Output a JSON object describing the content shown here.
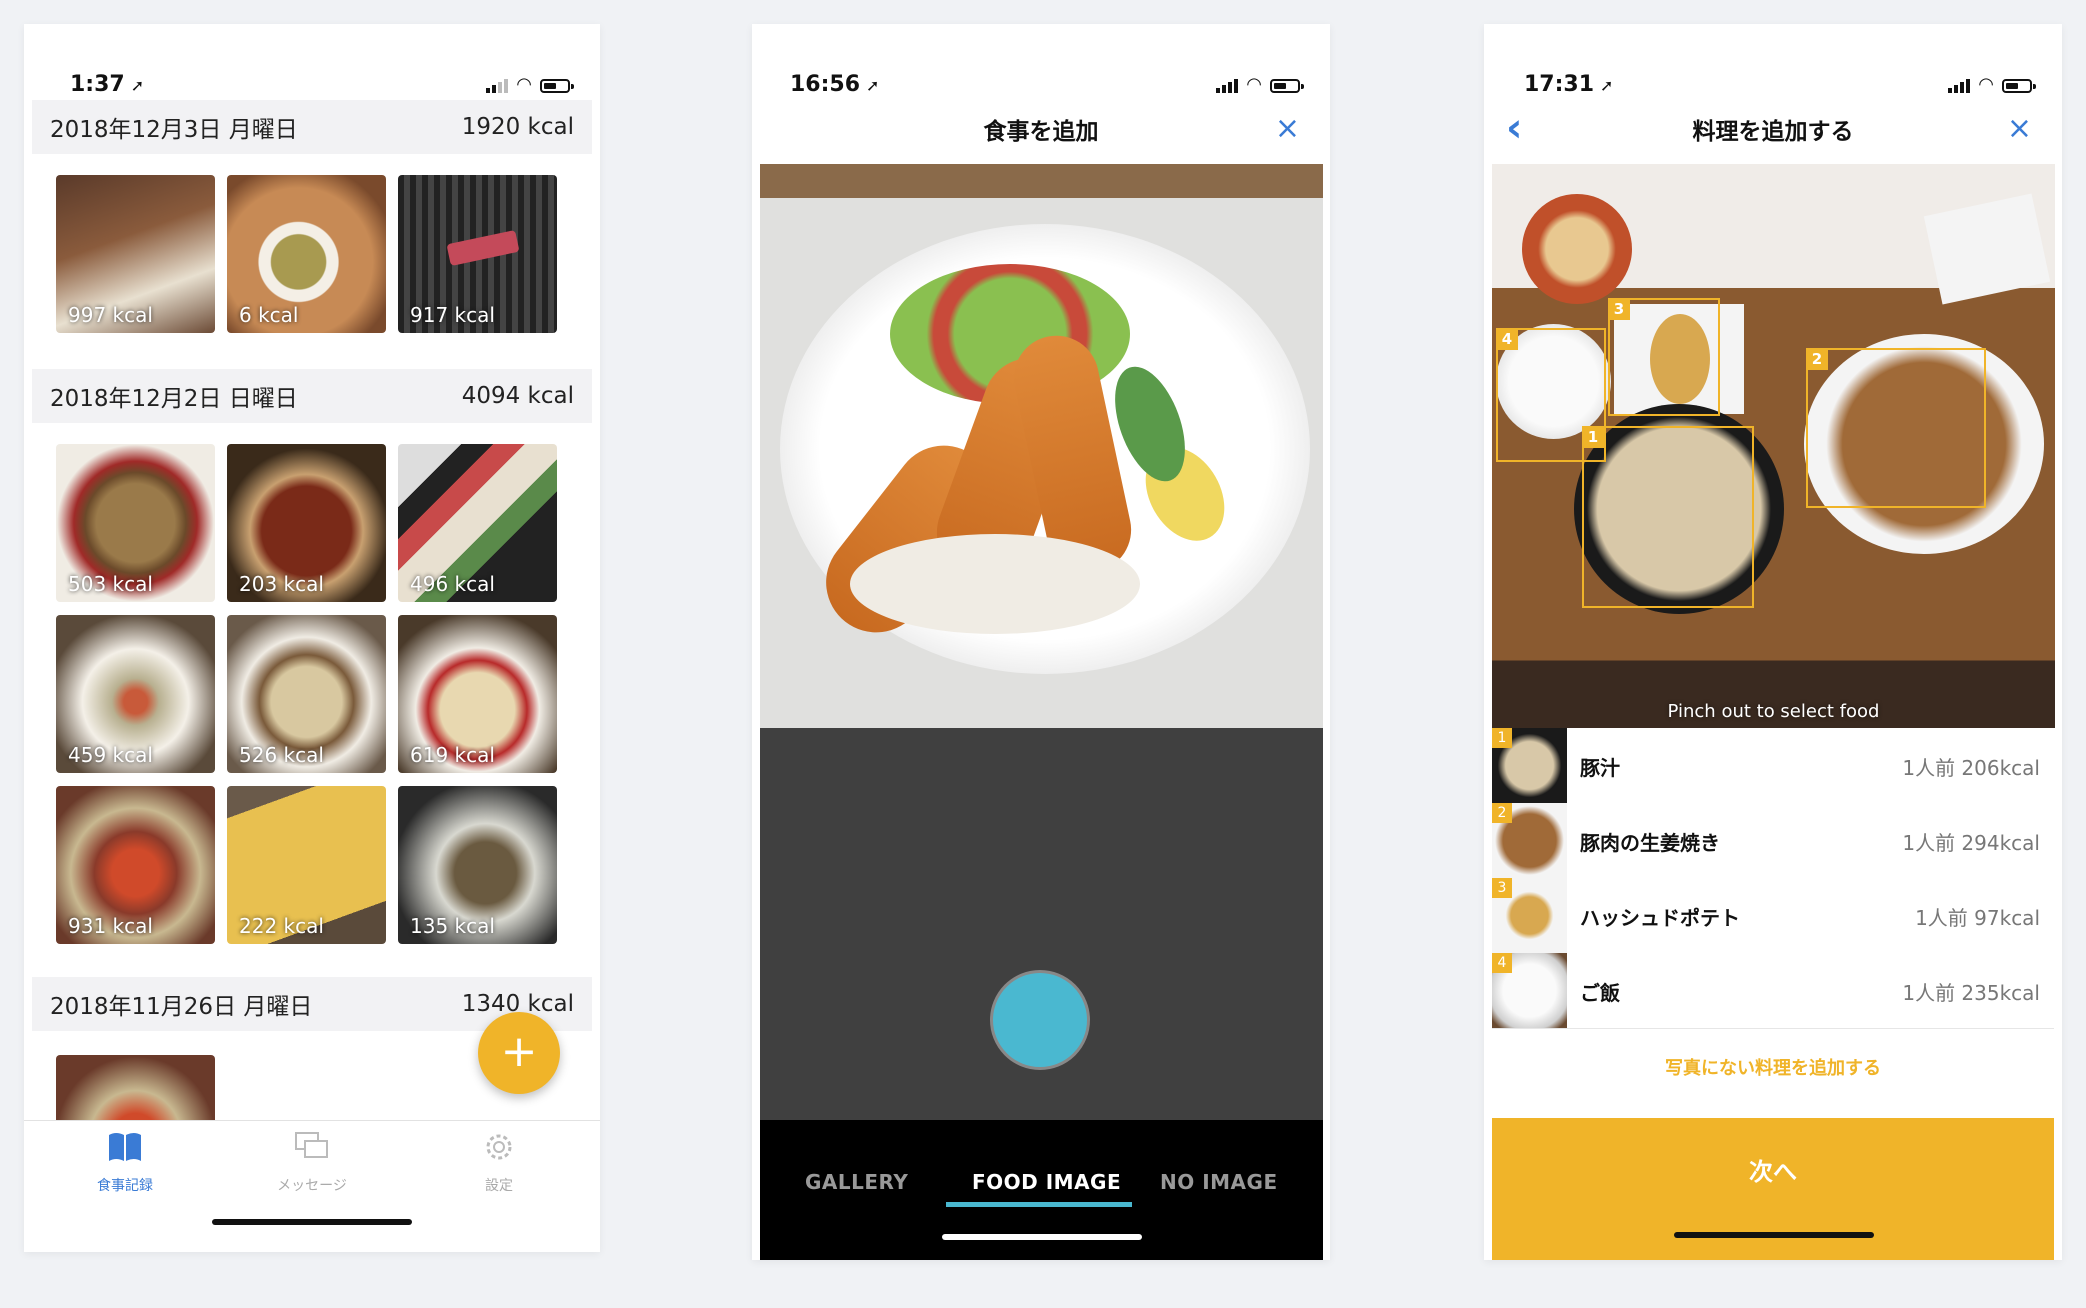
{
  "phone1": {
    "time": "1:37",
    "days": [
      {
        "date": "2018年12月3日 月曜日",
        "kcal": "1920 kcal",
        "items": [
          "997 kcal",
          "6 kcal",
          "917 kcal"
        ]
      },
      {
        "date": "2018年12月2日 日曜日",
        "kcal": "4094 kcal",
        "items": [
          "503 kcal",
          "203 kcal",
          "496 kcal",
          "459 kcal",
          "526 kcal",
          "619 kcal",
          "931 kcal",
          "222 kcal",
          "135 kcal"
        ]
      },
      {
        "date": "2018年11月26日 月曜日",
        "kcal": "1340 kcal",
        "items": []
      }
    ],
    "fab_label": "+",
    "tabs": [
      {
        "label": "食事記録",
        "icon": "book-icon",
        "active": true
      },
      {
        "label": "メッセージ",
        "icon": "chat-icon",
        "active": false
      },
      {
        "label": "設定",
        "icon": "gear-icon",
        "active": false
      }
    ]
  },
  "phone2": {
    "time": "16:56",
    "title": "食事を追加",
    "close": "×",
    "tabs": [
      {
        "label": "GALLERY",
        "active": false
      },
      {
        "label": "FOOD IMAGE",
        "active": true
      },
      {
        "label": "NO IMAGE",
        "active": false
      }
    ]
  },
  "phone3": {
    "time": "17:31",
    "title": "料理を追加する",
    "back": "‹",
    "close": "×",
    "hint": "Pinch out to select food",
    "dishes": [
      {
        "num": "1",
        "name": "豚汁",
        "kcal": "1人前 206kcal"
      },
      {
        "num": "2",
        "name": "豚肉の生姜焼き",
        "kcal": "1人前 294kcal"
      },
      {
        "num": "3",
        "name": "ハッシュドポテト",
        "kcal": "1人前 97kcal"
      },
      {
        "num": "4",
        "name": "ご飯",
        "kcal": "1人前 235kcal"
      }
    ],
    "box_labels": [
      "1",
      "2",
      "3",
      "4"
    ],
    "add_link": "写真にない料理を追加する",
    "next_button": "次へ"
  },
  "colors": {
    "accent": "#f0b429",
    "blue": "#3a7bd5",
    "capture": "#4ab8d0"
  }
}
